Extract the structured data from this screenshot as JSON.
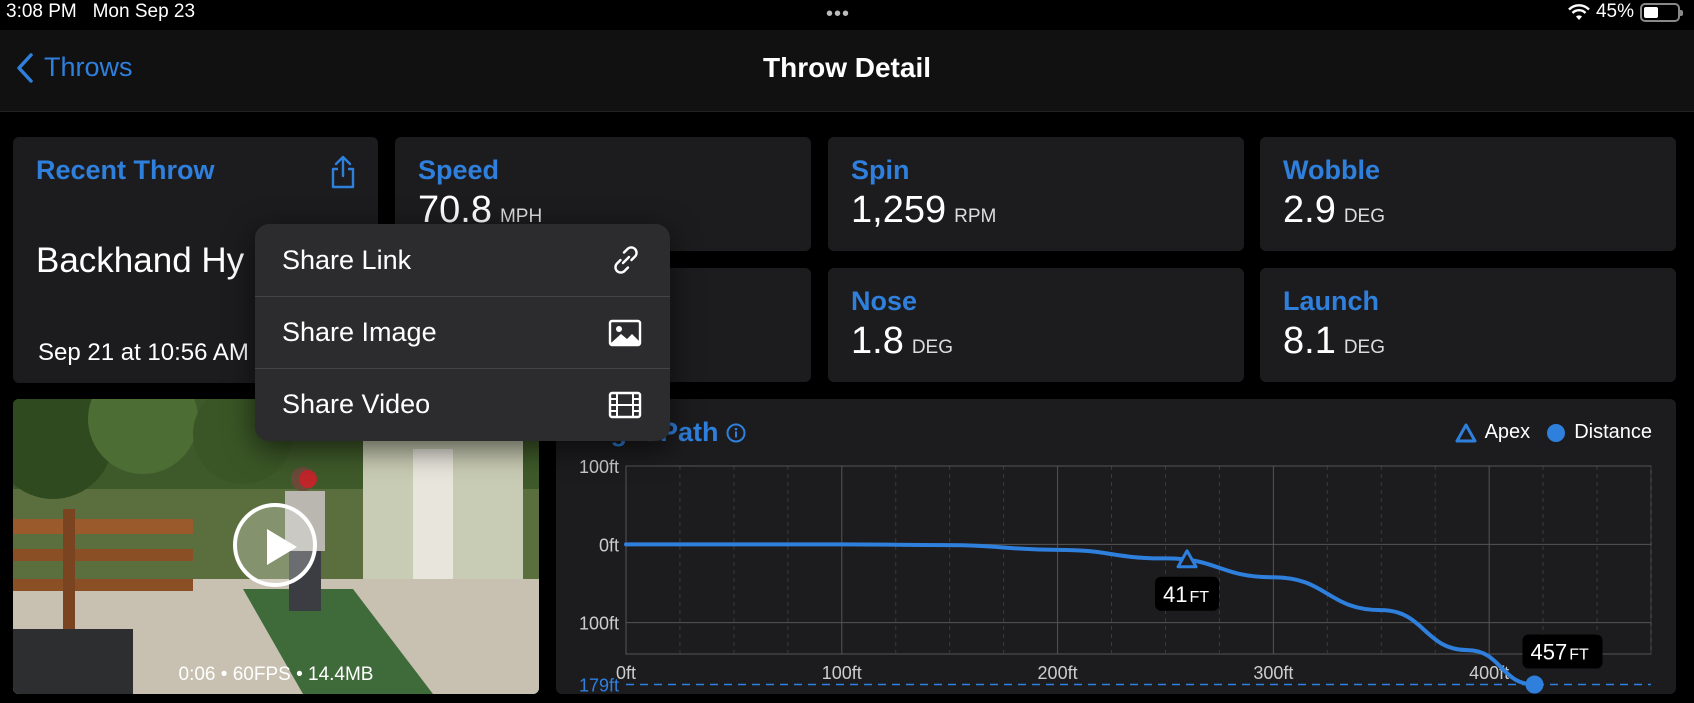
{
  "status_bar": {
    "time": "3:08 PM",
    "date": "Mon Sep 23",
    "battery": "45%",
    "battery_level": 0.45
  },
  "nav": {
    "back_label": "Throws",
    "title": "Throw Detail"
  },
  "recent_throw": {
    "title": "Recent Throw",
    "name": "Backhand Hy",
    "date": "Sep 21 at 10:56 AM"
  },
  "metrics": [
    {
      "label": "Speed",
      "value": "70.8",
      "unit": "MPH"
    },
    {
      "label": "Spin",
      "value": "1,259",
      "unit": "RPM"
    },
    {
      "label": "Wobble",
      "value": "2.9",
      "unit": "DEG"
    },
    {
      "label": "",
      "value": "",
      "unit": ""
    },
    {
      "label": "Nose",
      "value": "1.8",
      "unit": "DEG"
    },
    {
      "label": "Launch",
      "value": "8.1",
      "unit": "DEG"
    }
  ],
  "video": {
    "meta": "0:06  •  60FPS  •  14.4MB"
  },
  "share_menu": {
    "items": [
      {
        "label": "Share Link",
        "icon": "link-icon"
      },
      {
        "label": "Share Image",
        "icon": "photo-icon"
      },
      {
        "label": "Share Video",
        "icon": "film-icon"
      }
    ]
  },
  "flight_path": {
    "title": "Flight Path",
    "legend": {
      "apex": "Apex",
      "distance": "Distance"
    },
    "apex_label": {
      "value": "41",
      "unit": "FT"
    },
    "distance_label": {
      "value": "457",
      "unit": "FT"
    },
    "accent_color": "#2f7fdd"
  },
  "chart_data": {
    "type": "line",
    "title": "Flight Path",
    "x_ticks": [
      "0ft",
      "100ft",
      "200ft",
      "300ft",
      "400ft"
    ],
    "y_ticks": [
      "100ft",
      "0ft",
      "100ft"
    ],
    "xlim": [
      0,
      475
    ],
    "ylim": [
      -100,
      200
    ],
    "min_line_label": "179ft",
    "min_line_value": 179,
    "series": [
      {
        "name": "Flight Path",
        "points": [
          [
            0,
            0
          ],
          [
            100,
            0
          ],
          [
            150,
            1
          ],
          [
            200,
            7
          ],
          [
            250,
            18
          ],
          [
            300,
            42
          ],
          [
            350,
            84
          ],
          [
            390,
            135
          ],
          [
            421,
            179
          ]
        ]
      }
    ],
    "apex": {
      "x": 260,
      "y": 21,
      "label": "41FT"
    },
    "distance": {
      "x": 421,
      "y": 179,
      "label": "457FT"
    },
    "grid": true,
    "legend_position": "top-right"
  }
}
